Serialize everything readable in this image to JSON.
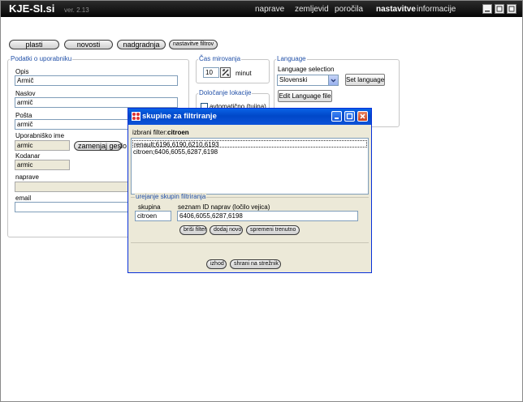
{
  "header": {
    "brand": "KJE-SI.si",
    "version": "ver. 2.13",
    "nav": [
      "naprave",
      "zemljevid",
      "poročila"
    ],
    "nav_active": "nastavitve",
    "nav_last": "informacije"
  },
  "toolbar": {
    "plasti": "plasti",
    "novosti": "novosti",
    "nadgradnja": "nadgradnja",
    "filter_settings": "nastavitve filtrov"
  },
  "user_panel": {
    "legend": "Podatki o uporabniku",
    "opis_label": "Opis",
    "opis_value": "Armič",
    "naslov_label": "Naslov",
    "naslov_value": "armič",
    "posta_label": "Pošta",
    "posta_value": "armič",
    "username_label": "Uporabniško ime",
    "username_value": "armic",
    "change_password": "zamenjaj geslo",
    "kodanar_label": "Kodanar",
    "kodanar_value": "armic",
    "naprave_label": "naprave",
    "naprave_value": "",
    "email_label": "email",
    "email_value": ""
  },
  "time_panel": {
    "legend": "Čas mirovanja",
    "value": "10",
    "unit": "minut"
  },
  "location_panel": {
    "legend": "Določanje lokacije",
    "auto_label": "avtomatično (tujina)"
  },
  "language_panel": {
    "legend": "Language",
    "selection_label": "Language selection",
    "selected": "Slovenski",
    "set_button": "Set language",
    "edit_button": "Edit Language file"
  },
  "dialog": {
    "title": "skupine za filtriranje",
    "selected_filter_label": "izbrani filter:",
    "selected_filter_value": "citroen",
    "list": [
      "renault;6196,6190,6210,6193",
      "citroen;6406,6055,6287,6198"
    ],
    "edit_legend": "urejanje skupin filtriranja",
    "group_label": "skupina",
    "group_value": "citroen",
    "ids_label": "seznam ID naprav (ločilo vejica)",
    "ids_value": "6406,6055,6287,6198",
    "delete_button": "briši filter",
    "add_button": "dodaj novo",
    "change_button": "spremeni trenutno",
    "exit_button": "izhod",
    "save_button": "shrani na strežnik"
  },
  "colors": {
    "titlebar": "#0a5fe2",
    "legend_text": "#2150a8",
    "header_bg": "#111111"
  }
}
